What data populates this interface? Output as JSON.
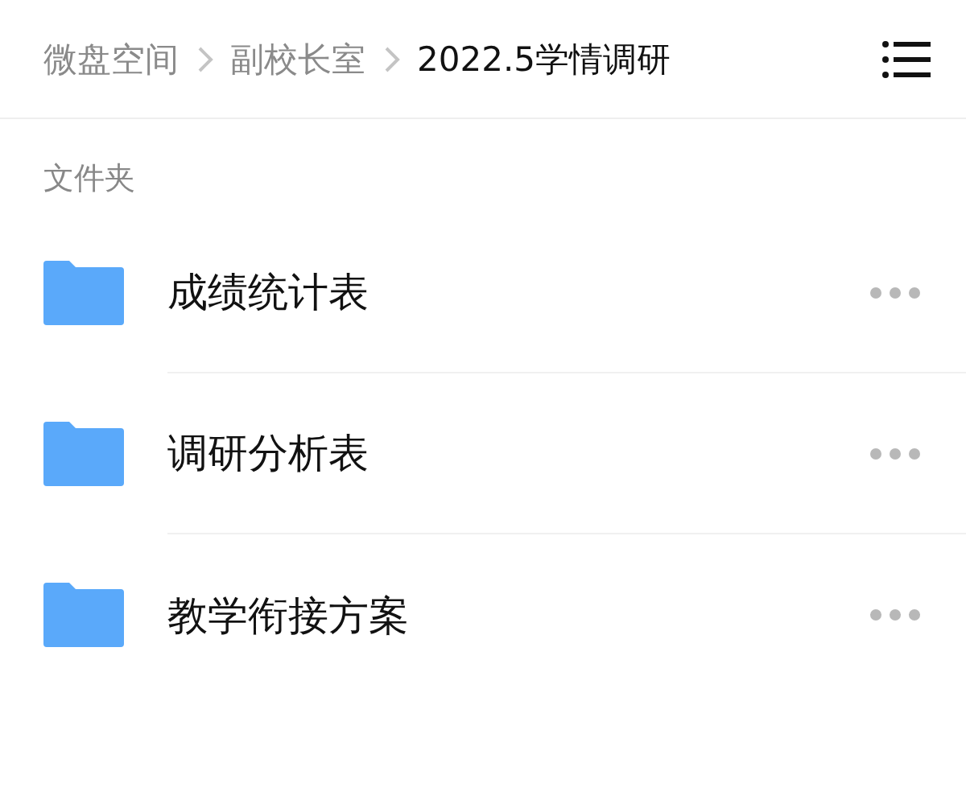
{
  "breadcrumb": [
    {
      "label": "微盘空间",
      "current": false
    },
    {
      "label": "副校长室",
      "current": false
    },
    {
      "label": "2022.5学情调研",
      "current": true
    }
  ],
  "section_label": "文件夹",
  "folders": [
    {
      "name": "成绩统计表"
    },
    {
      "name": "调研分析表"
    },
    {
      "name": "教学衔接方案"
    }
  ]
}
